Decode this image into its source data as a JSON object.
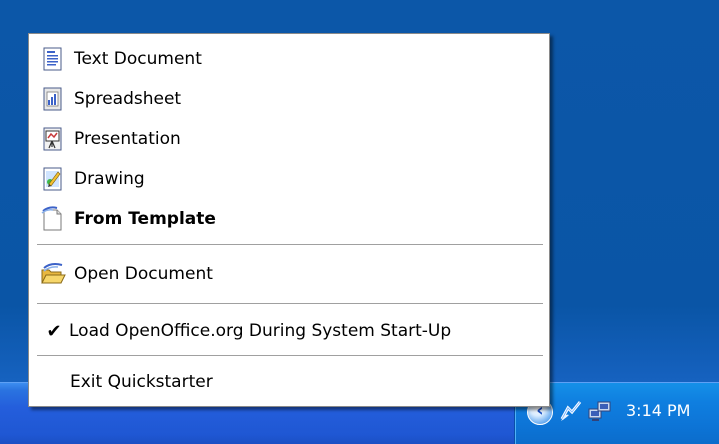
{
  "menu": {
    "items": [
      {
        "label": "Text Document",
        "icon": "text-document-icon"
      },
      {
        "label": "Spreadsheet",
        "icon": "spreadsheet-icon"
      },
      {
        "label": "Presentation",
        "icon": "presentation-icon"
      },
      {
        "label": "Drawing",
        "icon": "drawing-icon"
      },
      {
        "label": "From Template",
        "icon": "template-icon"
      },
      {
        "label": "Open Document",
        "icon": "open-folder-icon"
      },
      {
        "label": "Load OpenOffice.org During System Start-Up",
        "icon": "checkmark-icon",
        "checked": true
      },
      {
        "label": "Exit Quickstarter"
      }
    ]
  },
  "tray": {
    "clock": "3:14 PM",
    "icons": [
      "show-hidden-icons-chevron-icon",
      "openoffice-quickstarter-icon",
      "network-connection-icon"
    ]
  },
  "colors": {
    "desktop": "#0b58ab",
    "taskbar": "#245edc",
    "tray": "#0f7fe0",
    "menu_background": "#ffffff"
  }
}
